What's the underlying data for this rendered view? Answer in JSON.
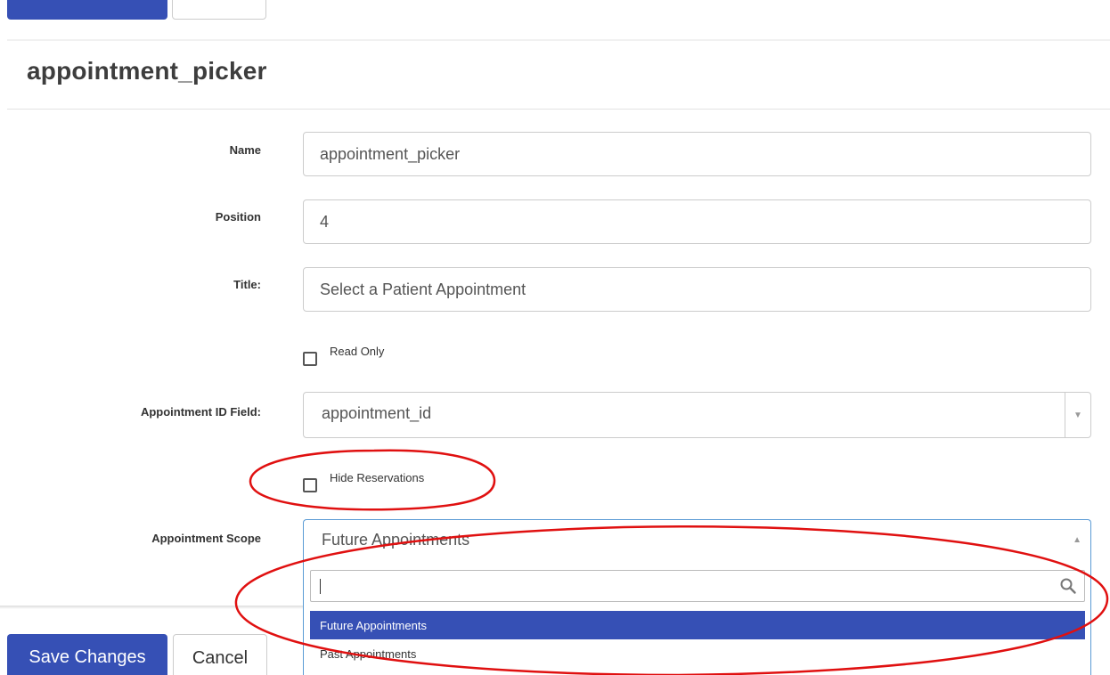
{
  "page": {
    "title": "appointment_picker"
  },
  "form": {
    "name": {
      "label": "Name",
      "value": "appointment_picker"
    },
    "position": {
      "label": "Position",
      "value": "4"
    },
    "title": {
      "label": "Title:",
      "value": "Select a Patient Appointment"
    },
    "read_only": {
      "label": "Read Only",
      "checked": false
    },
    "appointment_id_field": {
      "label": "Appointment ID Field:",
      "value": "appointment_id"
    },
    "hide_reservations": {
      "label": "Hide Reservations",
      "checked": false
    },
    "appointment_scope": {
      "label": "Appointment Scope",
      "value": "Future Appointments",
      "search_value": "",
      "options": [
        "Future Appointments",
        "Past Appointments"
      ],
      "selected_index": 0
    }
  },
  "actions": {
    "save_label": "Save Changes",
    "cancel_label": "Cancel"
  },
  "colors": {
    "primary": "#3650b5",
    "annotation": "#e01010",
    "focus_border": "#5b9bd5"
  },
  "icons": {
    "select_arrow": "chevron-down-icon",
    "open_arrow": "chevron-up-icon",
    "search": "search-icon"
  }
}
